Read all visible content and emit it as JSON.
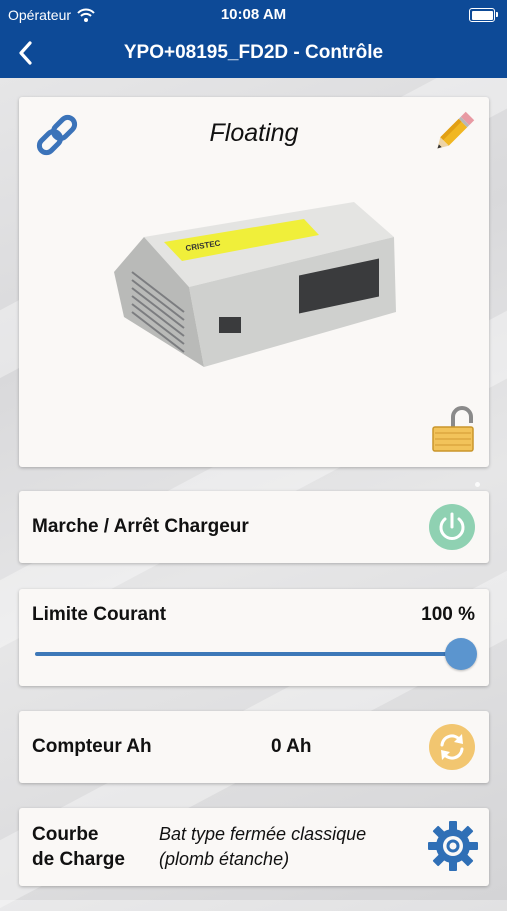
{
  "status_bar": {
    "carrier": "Opérateur",
    "time": "10:08 AM"
  },
  "header": {
    "title": "YPO+08195_FD2D - Contrôle",
    "back_icon": "chevron-left-icon",
    "color": "#0d4a97"
  },
  "status_card": {
    "state": "Floating",
    "link_icon": "chain-link-icon",
    "edit_icon": "pencil-icon",
    "lock_icon": "unlocked-padlock-icon",
    "device_label": "CRISTEC"
  },
  "charger_toggle": {
    "label": "Marche / Arrêt Chargeur",
    "icon": "power-icon",
    "color": "#8fd1b2"
  },
  "current_limit": {
    "label": "Limite Courant",
    "value_text": "100 %",
    "value_percent": 100
  },
  "ah_counter": {
    "label": "Compteur Ah",
    "value": "0 Ah",
    "icon": "refresh-icon",
    "color": "#f2c670"
  },
  "charge_curve": {
    "label_line1": "Courbe",
    "label_line2": "de Charge",
    "value_line1": "Bat type fermée classique",
    "value_line2": "(plomb étanche)",
    "icon": "gear-icon"
  }
}
